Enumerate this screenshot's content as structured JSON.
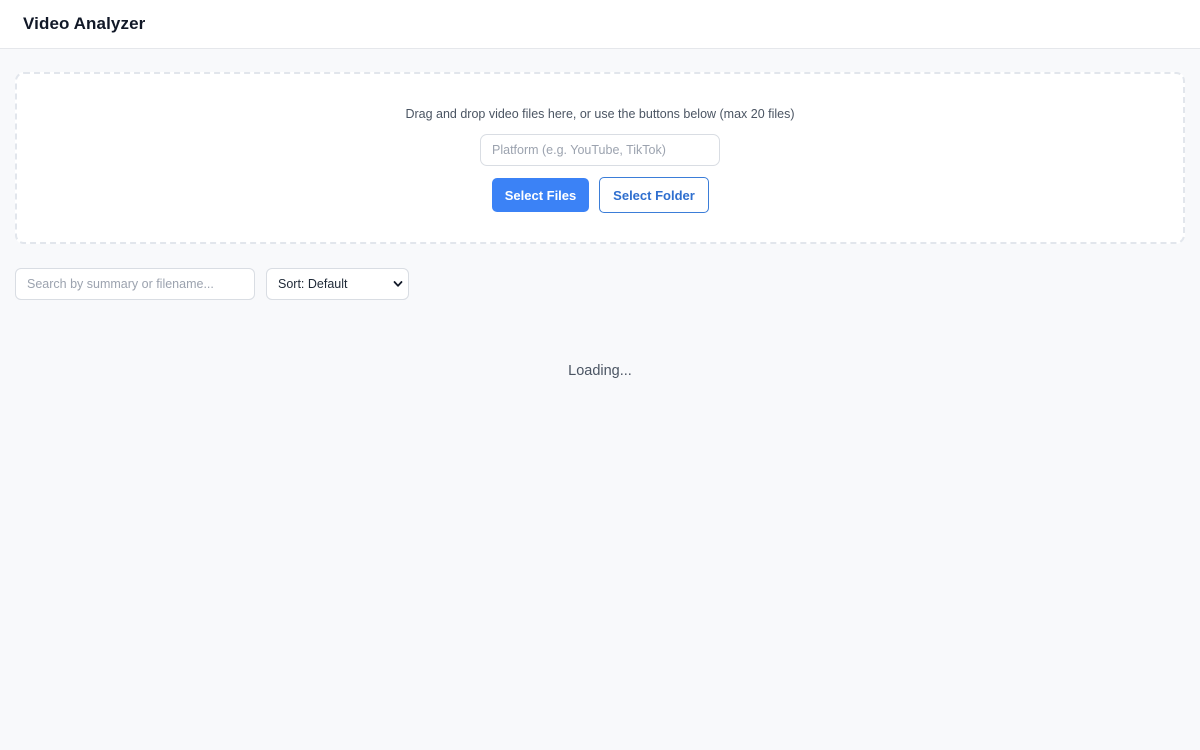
{
  "header": {
    "title": "Video Analyzer"
  },
  "upload": {
    "hint": "Drag and drop video files here, or use the buttons below (max 20 files)",
    "platform_placeholder": "Platform (e.g. YouTube, TikTok)",
    "platform_value": "",
    "select_files_label": "Select Files",
    "select_folder_label": "Select Folder"
  },
  "filters": {
    "search_placeholder": "Search by summary or filename...",
    "search_value": "",
    "sort_selected": "Sort: Default",
    "sort_icon": "chevron-down-icon"
  },
  "status": {
    "loading_text": "Loading..."
  },
  "colors": {
    "accent": "#3b82f6",
    "background": "#f8f9fb",
    "border": "#e2e6ec"
  }
}
